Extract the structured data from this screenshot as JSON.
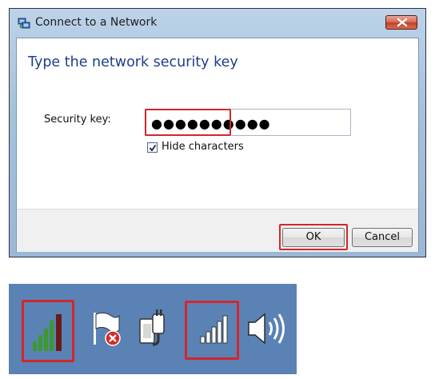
{
  "dialog": {
    "title": "Connect to a Network",
    "heading": "Type the network security key",
    "security_key_label": "Security key:",
    "security_key_value": "●●●●●●●●●●",
    "hide_characters_label": "Hide characters",
    "hide_characters_checked": true,
    "ok_label": "OK",
    "cancel_label": "Cancel"
  },
  "tray": {
    "icons": [
      "wireless-signal-icon",
      "action-center-icon",
      "power-plug-icon",
      "signal-bars-icon",
      "speaker-volume-icon"
    ]
  },
  "colors": {
    "highlight": "#d3262d",
    "heading": "#1e3f8a",
    "tray_background": "#5a82b4"
  }
}
